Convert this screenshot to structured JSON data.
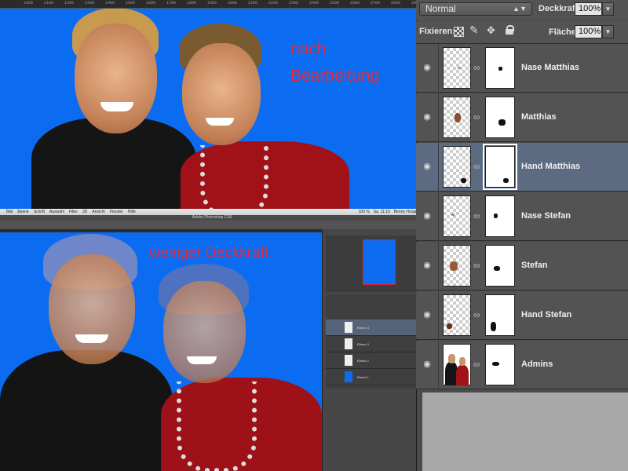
{
  "top_ruler_ticks": [
    "1000",
    "1100",
    "1200",
    "1300",
    "1400",
    "1500",
    "1600",
    "1700",
    "1800",
    "1900",
    "2000",
    "2100",
    "2200",
    "2300",
    "2400",
    "2500",
    "2600",
    "2700",
    "2800",
    "2900"
  ],
  "annotations": {
    "top_line1": "nach",
    "top_line2": "Bearbeitung",
    "bottom": "weniger Deckkraft"
  },
  "menubar": {
    "items": [
      "Bild",
      "Ebene",
      "Schrift",
      "Auswahl",
      "Filter",
      "3D",
      "Ansicht",
      "Fenster",
      "Hilfe"
    ],
    "status": [
      "100 %",
      "Sa. 11:10",
      "Benny Hoojaan"
    ]
  },
  "ps_title": "Adobe Photoshop CS6",
  "mini_layers": [
    "Ebene 3",
    "Ebene 3",
    "Ebene 2",
    "Ebene 1"
  ],
  "layers_panel": {
    "blend_mode": "Normal",
    "opacity_label": "Deckkraft:",
    "opacity_value": "100%",
    "lock_label": "Fixieren:",
    "fill_label": "Fläche:",
    "fill_value": "100%",
    "layers": [
      {
        "name": "Nase Matthias",
        "selected": false
      },
      {
        "name": "Matthias",
        "selected": false
      },
      {
        "name": "Hand Matthias",
        "selected": true
      },
      {
        "name": "Nase Stefan",
        "selected": false
      },
      {
        "name": "Stefan",
        "selected": false
      },
      {
        "name": "Hand Stefan",
        "selected": false
      },
      {
        "name": "Admins",
        "selected": false
      }
    ]
  },
  "icons": [
    "eye-icon",
    "chain-link-icon",
    "lock-transparent-icon",
    "brush-icon",
    "move-icon",
    "lock-icon",
    "dropdown-arrow-icon"
  ],
  "colors": {
    "canvas_blue": "#0b6cf2",
    "annotation_red": "#e52b3b",
    "selected_layer": "#5c6b81"
  }
}
